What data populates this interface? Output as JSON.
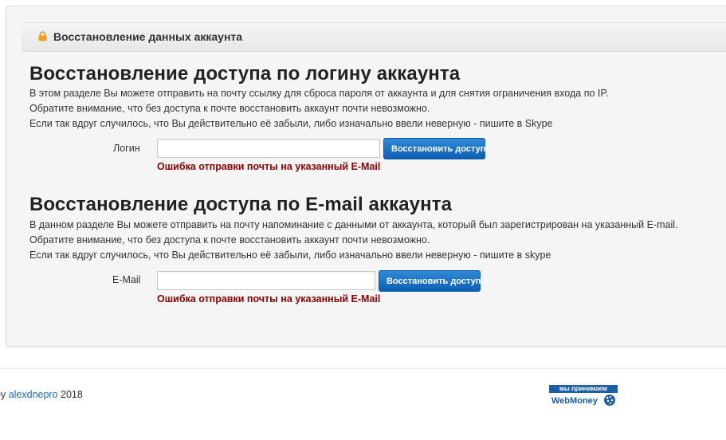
{
  "panel": {
    "title": "Восстановление данных аккаунта"
  },
  "login_section": {
    "title": "Восстановление доступа по логину аккаунта",
    "lines": [
      "В этом разделе Вы можете отправить на почту ссылку для сброса пароля от аккаунта и для снятия ограничения входа по IP.",
      "Обратите внимание, что без доступа к почте восстановить аккаунт почти невозможно.",
      "Если так вдруг случилось, что Вы действительно её забыли, либо изначально ввели неверную - пишите в Skype"
    ],
    "field_label": "Логин",
    "input_value": "",
    "button_label": "Восстановить доступ",
    "error": "Ошибка отправки почты на указанный E-Mail"
  },
  "email_section": {
    "title": "Восстановление доступа по E-mail аккаунта",
    "lines": [
      "В данном разделе Вы можете отправить на почту напоминание с данными от аккаунта, который был зарегистрирован на указанный E-mail.",
      "Обратите внимание, что без доступа к почте восстановить аккаунт почти невозможно.",
      "Если так вдруг случилось, что Вы действительно её забыли, либо изначально ввели неверную - пишите в skype"
    ],
    "field_label": "E-Mail",
    "input_value": "",
    "button_label": "Восстановить доступ",
    "error": "Ошибка отправки почты на указанный E-Mail"
  },
  "footer": {
    "prefix": "by ",
    "author_link": "alexdnepro",
    "year": " 2018",
    "badge_top": "мы принимаем",
    "badge_name": "WebMoney"
  },
  "colors": {
    "accent": "#0e5fb4",
    "error": "#8b0000",
    "link": "#1e6fb8",
    "lock": "#f0a020"
  }
}
